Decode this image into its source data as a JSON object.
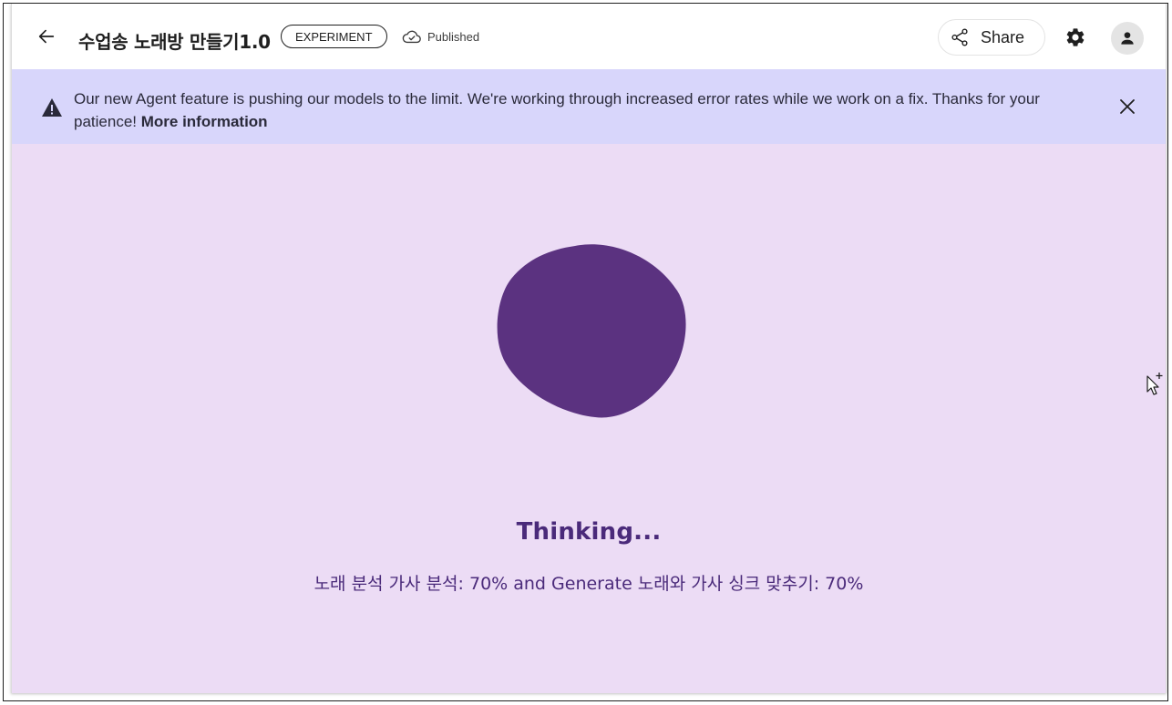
{
  "header": {
    "title": "수업송 노래방 만들기1.0",
    "badge": "EXPERIMENT",
    "status": "Published",
    "share_label": "Share",
    "icons": {
      "back": "arrow-left-icon",
      "status": "cloud-done-icon",
      "share": "share-icon",
      "settings": "gear-icon",
      "avatar": "person-icon"
    }
  },
  "banner": {
    "message": "Our new Agent feature is pushing our models to the limit. We're working through increased error rates while we work on a fix. Thanks for your patience!",
    "link": "More information",
    "icons": {
      "warning": "warning-icon",
      "close": "close-icon"
    }
  },
  "main": {
    "heading": "Thinking...",
    "progress": "노래 분석 가사 분석: 70% and Generate 노래와 가사 싱크 맞추기: 70%"
  },
  "colors": {
    "banner_bg": "#d8d6fb",
    "main_bg": "#ecdcf5",
    "blob": "#5b3280",
    "accent_text": "#4a2a7a"
  }
}
